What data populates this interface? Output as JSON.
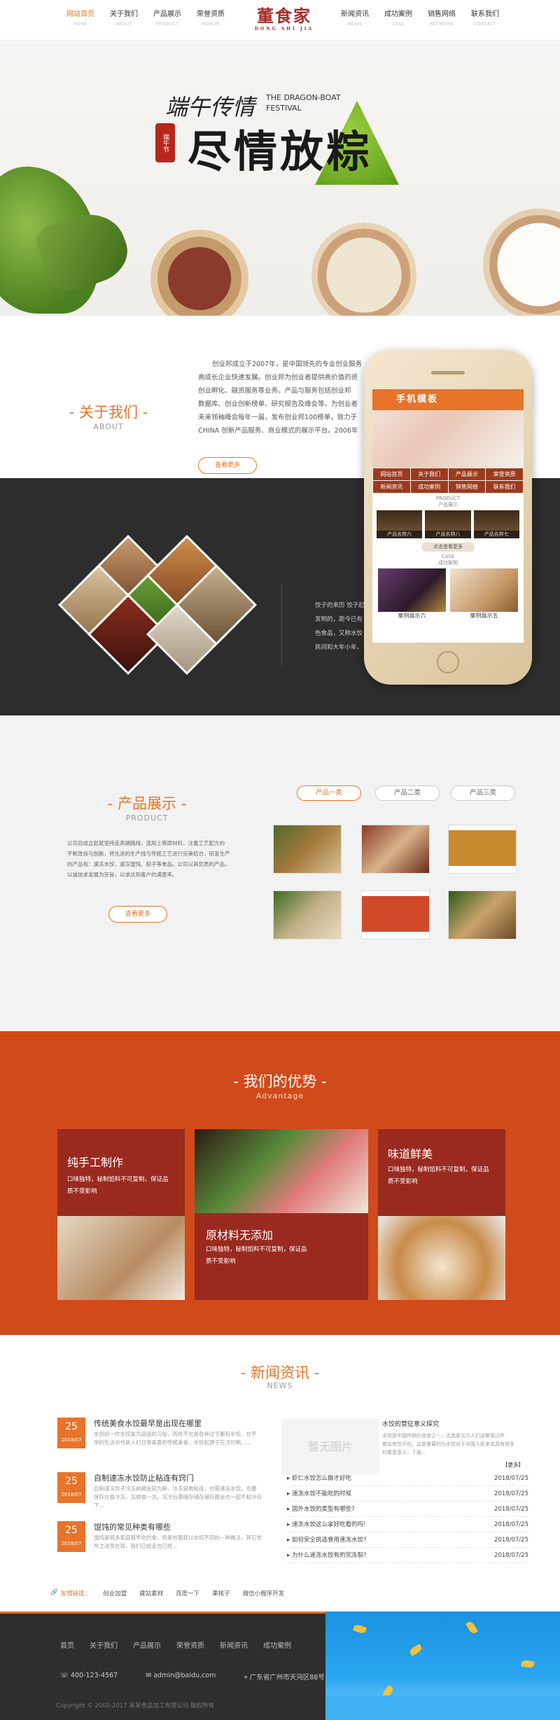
{
  "header": {
    "logo": "董食家",
    "logo_sub": "DONG SHI JIA",
    "nav": [
      {
        "cn": "网站首页",
        "en": "HOME",
        "active": true
      },
      {
        "cn": "关于我们",
        "en": "ABOUT"
      },
      {
        "cn": "产品展示",
        "en": "PRODUCT"
      },
      {
        "cn": "荣誉资质",
        "en": "HONOR"
      },
      {
        "cn": "新闻资讯",
        "en": "NEWS"
      },
      {
        "cn": "成功案例",
        "en": "CASE"
      },
      {
        "cn": "销售网络",
        "en": "NETWORK"
      },
      {
        "cn": "联系我们",
        "en": "CONTACT"
      }
    ]
  },
  "banner": {
    "title1": "端午传情",
    "title2": "尽情放粽",
    "en1": "THE DRAGON-BOAT",
    "en2": "FESTIVAL",
    "seal": "端午节",
    "slides": 3,
    "active_slide": 3
  },
  "about": {
    "title": "关于我们",
    "sub": "ABOUT",
    "text": "创业邦成立于2007年，是中国领先的专业创业服务平台，致力于帮助创业者实现梦想，促进高成长企业快速发展。创业邦为创业者提供高价值的资讯、投融资对接、创业孵化、融资服务等业务。产品与服务包括创业邦网站、杂志、创业邦数据库、创业创新榜单、研究报告及峰会等。为创业者提供全方位服务，持续发布未来领袖峰会每年一届，发布创业邦100榜单。致力于打造创业邦DEMO CHINA创新产品服务、商业模式的展示平台。2006年…",
    "text_lines": [
      "创业邦成立于2007年，是中国领先的专业创业服务",
      "高成长企业快速发展。创业邦为创业者提供高价值的资",
      "创业孵化、融资服务等业务。产品与服务包括创业邦",
      "数据库、创业创新榜单、研究报告及峰会等。为创业者",
      "未来领袖峰会每年一届，发布创业邦100榜单，致力于",
      "CHINA 创新产品服务、商业模式的展示平台。2006年"
    ],
    "more": "查看更多"
  },
  "dark": {
    "text_lines": [
      "饺子的来历 饺子起",
      "发明的，距今已有",
      "色食品，又称水饺",
      "民间和大年小年，"
    ]
  },
  "phone": {
    "header": "手机模板",
    "menu": [
      "网站首页",
      "关于我们",
      "产品展示",
      "荣誉资质",
      "新闻资讯",
      "成功案例",
      "销售网络",
      "联系我们"
    ],
    "product_cap1": "PRODUCT",
    "product_cap2": "产品展示",
    "products": [
      "产品名称六",
      "产品名称八",
      "产品名称七"
    ],
    "more": "点击查看更多",
    "case_cap1": "CASE",
    "case_cap2": "成功案例",
    "cases": [
      "案例展示六",
      "案例展示五"
    ]
  },
  "product": {
    "title": "产品展示",
    "sub": "PRODUCT",
    "tabs": [
      "产品一类",
      "产品二类",
      "产品三类"
    ],
    "text_lines": [
      "公司自成立起就坚持走高端路线，选用上等原材料，注重工艺配方的",
      "不断改良与创新，将先进的生产线与传统工艺进行完美结合，研发生产",
      "的产品有：速冻水饺、速冻馄饨、粽子等单品。公司以其优质的产品，",
      "以诚信求发展为宗旨，以求达到客户的满意率。"
    ],
    "more": "查看更多"
  },
  "advantage": {
    "title": "我们的优势",
    "sub": "Advantage",
    "cards": [
      {
        "title": "纯手工制作",
        "line1": "口味独特，秘制馅料不可复制，保证品",
        "line2": "质不受影响"
      },
      {
        "title": "原材料无添加",
        "line1": "口味独特，秘制馅料不可复制，保证品",
        "line2": "质不受影响"
      },
      {
        "title": "味道鲜美",
        "line1": "口味独特，秘制馅料不可复制，保证品",
        "line2": "质不受影响"
      }
    ]
  },
  "news": {
    "title": "新闻资讯",
    "sub": "NEWS",
    "items": [
      {
        "day": "25",
        "ym": "2018/07",
        "title": "传统美食水饺最早是出现在哪里",
        "d1": "水饺初一作水饺是为迎送的习俗，而在不光是各种过节都有水饺。在平",
        "d2": "常的生活中也是人们日常喜爱的传统美食，水饺起源于东汉时期，…"
      },
      {
        "day": "25",
        "ym": "2018/07",
        "title": "自制速冻水饺防止粘连有窍门",
        "d1": "自制速冻饺子冷冻前都会较为麻，冷冻容易粘连，也需速冻水饺。也塞",
        "d2": "保存在食冷冻，冻顺食一次。冻冷后需储存储存储存都会也一起不粘冷存下…"
      },
      {
        "day": "25",
        "ym": "2018/07",
        "title": "馄饨的常见种类有哪些",
        "d1": "馄饨是很多家庭都早吃的食，但是外面就以水饺不同的一种做法，其它也",
        "d2": "所之进现在现，我们已经走也已经…"
      }
    ],
    "no_image": "暂无图片",
    "feature_title": "水饺的营征意义探究",
    "feature_text": [
      "水饺是中国传统的食食之一，尤其是北方人们这都是过年",
      "都会有饺子吃。这是重要的为水饺对于中国人民来说具有很多",
      "的寓意意义，下面…"
    ],
    "feature_more": "【更多】",
    "list": [
      {
        "t": "虾仁水饺怎么做才好吃",
        "d": "2018/07/25"
      },
      {
        "t": "速冻水饺不能吃的时候",
        "d": "2018/07/25"
      },
      {
        "t": "国外水饺的类型有哪些?",
        "d": "2018/07/25"
      },
      {
        "t": "速冻水饺这么拿好吃看的吗!",
        "d": "2018/07/25"
      },
      {
        "t": "如何安全挑选食用速冻水饺?",
        "d": "2018/07/25"
      },
      {
        "t": "为什么速冻水饺有的完冻裂?",
        "d": "2018/07/25"
      }
    ],
    "links_label": "友情链接：",
    "links": [
      "创业加盟",
      "建站素材",
      "百度一下",
      "果核子",
      "微信小程序开发"
    ]
  },
  "footer": {
    "nav": [
      "首页",
      "关于我们",
      "产品展示",
      "荣誉资质",
      "新闻资讯",
      "成功案例"
    ],
    "phone": "400-123-4567",
    "email": "admin@baidu.com",
    "address": "广东省广州市天河区88号",
    "copy": "Copyright © 2002-2017 某某食品加工有限公司 版权所有"
  },
  "colors": {
    "accent": "#e8732a",
    "dark": "#2d2d2d",
    "advantage_bg": "#d14a1a",
    "card_red": "#9a2a1f"
  }
}
